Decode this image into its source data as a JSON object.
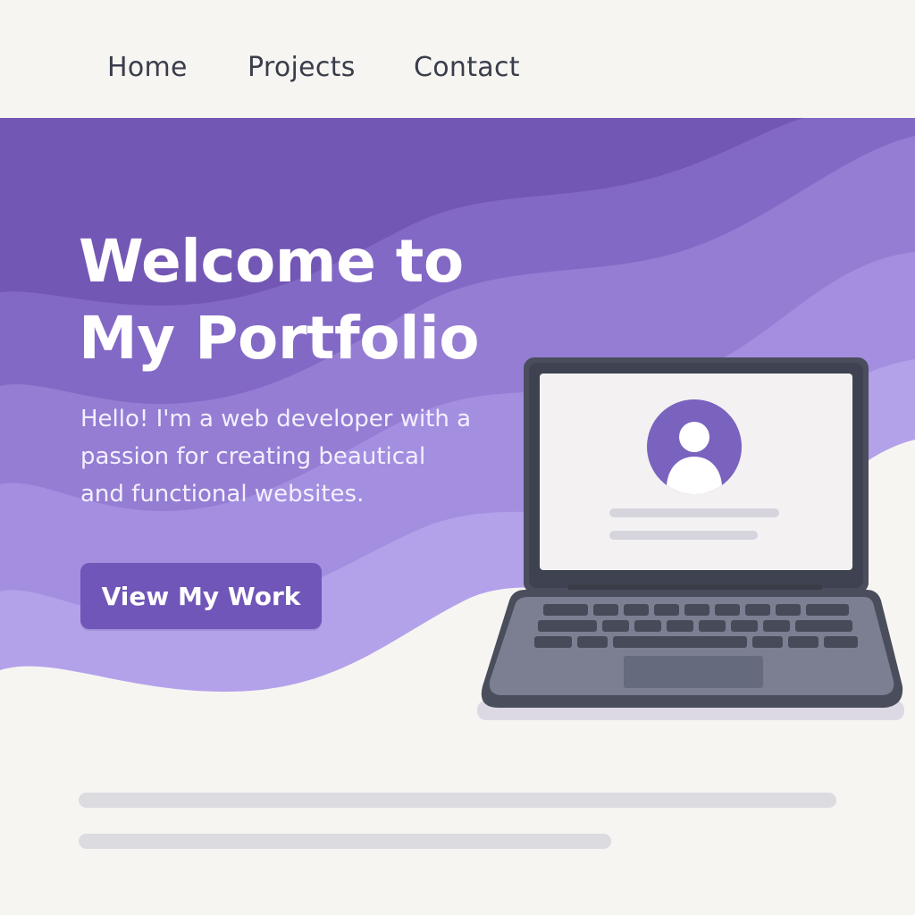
{
  "nav": {
    "items": [
      {
        "label": "Home"
      },
      {
        "label": "Projects"
      },
      {
        "label": "Contact"
      }
    ]
  },
  "hero": {
    "title_line1": "Welcome to",
    "title_line2": "My Portfolio",
    "description": "Hello! I'm a web developer with a passion for creating beautical and functional websites.",
    "cta_label": "View My Work"
  },
  "colors": {
    "accent": "#6f56b8",
    "hero_dark": "#7357b5",
    "hero_light": "#b3a2ea",
    "background": "#f7f5f2",
    "laptop_body": "#4a4d5c",
    "skeleton": "#dcdbe0"
  },
  "icons": {
    "profile": "user-avatar-icon"
  }
}
